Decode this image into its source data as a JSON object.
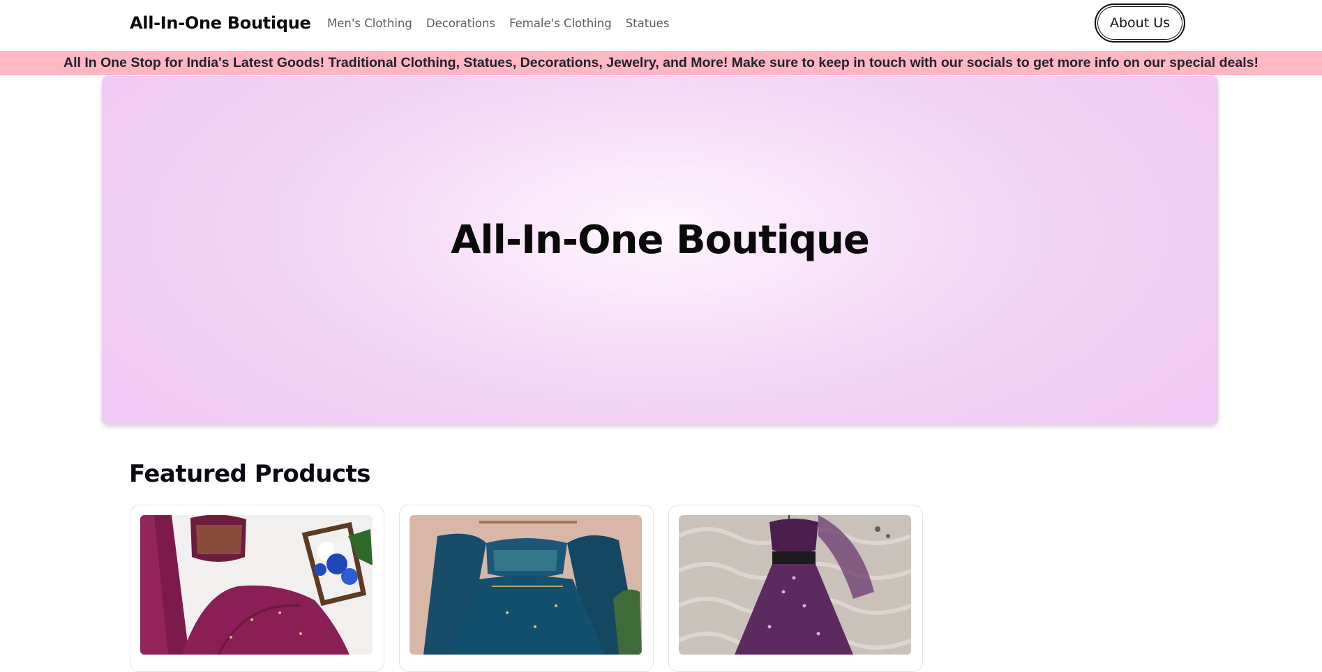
{
  "header": {
    "brand": "All-In-One Boutique",
    "nav": [
      {
        "label": "Men's Clothing"
      },
      {
        "label": "Decorations"
      },
      {
        "label": "Female's Clothing"
      },
      {
        "label": "Statues"
      }
    ],
    "about_label": "About Us"
  },
  "banner": {
    "text": "All In One Stop for India's Latest Goods! Traditional Clothing, Statues, Decorations, Jewelry, and More! Make sure to keep in touch with our socials to get more info on our special deals!"
  },
  "hero": {
    "title": "All-In-One Boutique"
  },
  "featured": {
    "title": "Featured Products",
    "products": [
      {
        "image": "maroon-lehenga-photo",
        "accent": "#8a1f55"
      },
      {
        "image": "teal-lehenga-photo",
        "accent": "#14506e"
      },
      {
        "image": "purple-lehenga-photo",
        "accent": "#5b2a5e"
      }
    ]
  },
  "colors": {
    "banner_bg": "#ffb6c5",
    "hero_bg": "#efcaf4",
    "text": "#111111",
    "nav_text": "#5b5b5b"
  }
}
